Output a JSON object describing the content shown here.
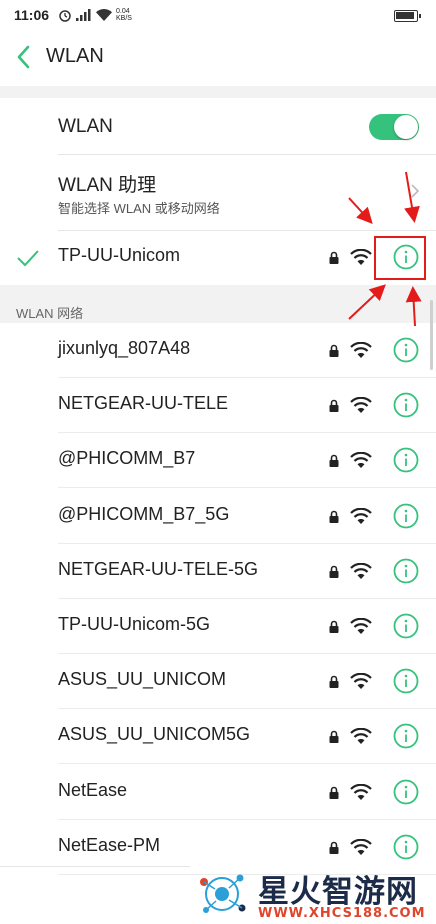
{
  "status_bar": {
    "time": "11:06",
    "net_speed_value": "0.04",
    "net_speed_unit": "KB/S",
    "icons": [
      "alarm-icon",
      "signal-icon",
      "wifi-icon",
      "battery-icon"
    ]
  },
  "header": {
    "title": "WLAN",
    "back_icon": "chevron-left-icon"
  },
  "settings": {
    "wlan_toggle_label": "WLAN",
    "wlan_toggle_on": true,
    "assistant_label": "WLAN 助理",
    "assistant_sub": "智能选择 WLAN 或移动网络"
  },
  "connected": {
    "name": "TP-UU-Unicom",
    "secured": true
  },
  "networks_section_title": "WLAN 网络",
  "networks": [
    {
      "name": "jixunlyq_807A48"
    },
    {
      "name": "NETGEAR-UU-TELE"
    },
    {
      "name": "@PHICOMM_B7"
    },
    {
      "name": "@PHICOMM_B7_5G"
    },
    {
      "name": "NETGEAR-UU-TELE-5G"
    },
    {
      "name": "TP-UU-Unicom-5G"
    },
    {
      "name": "ASUS_UU_UNICOM"
    },
    {
      "name": "ASUS_UU_UNICOM5G"
    },
    {
      "name": "NetEase"
    },
    {
      "name": "NetEase-PM"
    }
  ],
  "colors": {
    "accent": "#35c27c",
    "annotation": "#e31b1b"
  },
  "watermark": {
    "text": "星火智游网",
    "url": "WWW.XHCS188.COM"
  }
}
